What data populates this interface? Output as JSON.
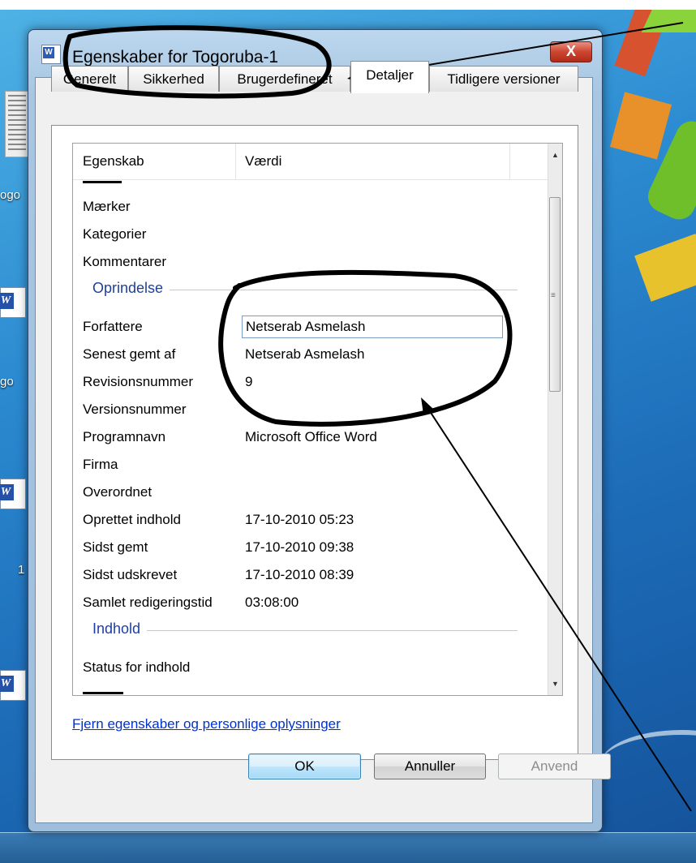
{
  "window": {
    "title": "Egenskaber for Togoruba-1",
    "close_label": "X"
  },
  "tabs": [
    {
      "label": "Generelt"
    },
    {
      "label": "Sikkerhed"
    },
    {
      "label": "Brugerdefineret"
    },
    {
      "label": "Detaljer"
    },
    {
      "label": "Tidligere versioner"
    }
  ],
  "active_tab": "Detaljer",
  "property_list": {
    "header": {
      "property": "Egenskab",
      "value": "Værdi"
    },
    "rows_top": [
      {
        "key": "Mærker",
        "value": ""
      },
      {
        "key": "Kategorier",
        "value": ""
      },
      {
        "key": "Kommentarer",
        "value": ""
      }
    ],
    "group_origin": "Oprindelse",
    "rows_origin": [
      {
        "key": "Forfattere",
        "value": "Netserab Asmelash"
      },
      {
        "key": "Senest gemt af",
        "value": "Netserab Asmelash"
      },
      {
        "key": "Revisionsnummer",
        "value": "9"
      },
      {
        "key": "Versionsnummer",
        "value": ""
      },
      {
        "key": "Programnavn",
        "value": "Microsoft Office Word"
      },
      {
        "key": "Firma",
        "value": ""
      },
      {
        "key": "Overordnet",
        "value": ""
      },
      {
        "key": "Oprettet indhold",
        "value": "17-10-2010 05:23"
      },
      {
        "key": "Sidst gemt",
        "value": "17-10-2010 09:38"
      },
      {
        "key": "Sidst udskrevet",
        "value": "17-10-2010 08:39"
      },
      {
        "key": "Samlet redigeringstid",
        "value": "03:08:00"
      }
    ],
    "group_content": "Indhold",
    "rows_content": [
      {
        "key": "Status for indhold",
        "value": ""
      }
    ]
  },
  "remove_link": "Fjern egenskaber og personlige oplysninger",
  "buttons": {
    "ok": "OK",
    "cancel": "Annuller",
    "apply": "Anvend"
  },
  "desktop": {
    "label_1": "ogo",
    "label_2": "go",
    "label_3": "1"
  },
  "colors": {
    "accent": "#1e3f9e",
    "link": "#0033cc",
    "close": "#c8412d"
  }
}
